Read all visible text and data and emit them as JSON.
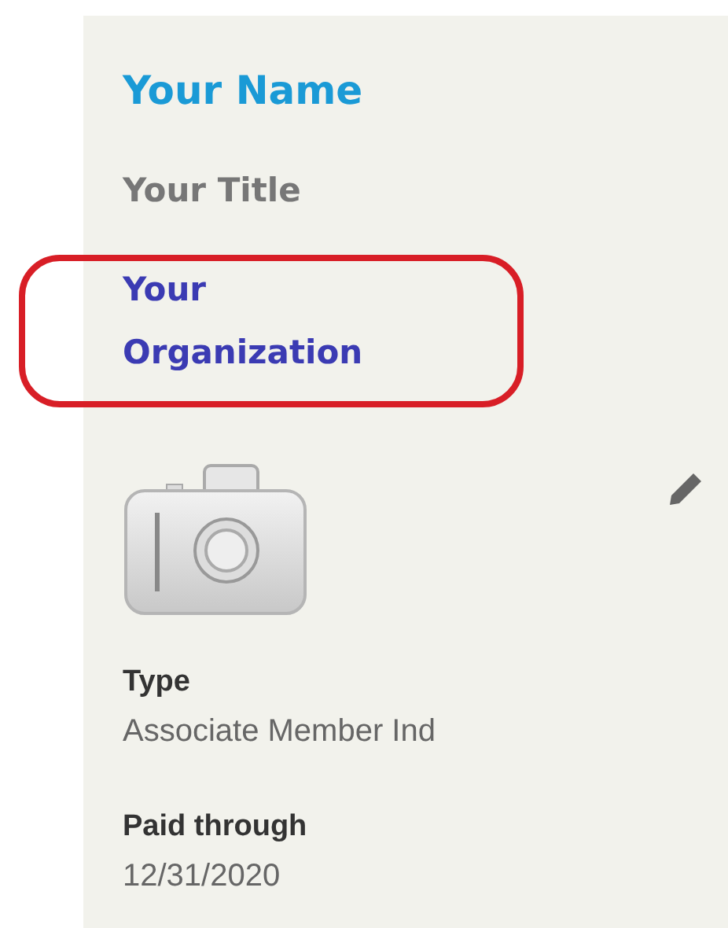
{
  "profile": {
    "name": "Your Name",
    "title": "Your Title",
    "organization": {
      "text": "Your Organization",
      "highlighted": true
    }
  },
  "fields": [
    {
      "label": "Type",
      "value": "Associate Member Ind"
    },
    {
      "label": "Paid through",
      "value": "12/31/2020"
    }
  ]
}
